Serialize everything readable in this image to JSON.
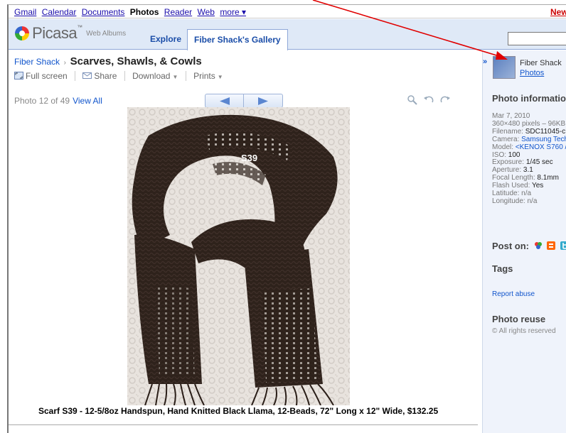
{
  "topnav": {
    "links": [
      "Gmail",
      "Calendar",
      "Documents",
      "Photos",
      "Reader",
      "Web"
    ],
    "current": "Photos",
    "more": "more ▾",
    "new_label": "New"
  },
  "header": {
    "logo_word": "Picasa",
    "logo_tm": "™",
    "logo_sub": "Web Albums",
    "tabs": [
      "Explore",
      "Fiber Shack's Gallery"
    ]
  },
  "breadcrumb": {
    "owner": "Fiber Shack",
    "separator": "›",
    "album": "Scarves, Shawls, & Cowls"
  },
  "toolbar": {
    "fullscreen": "Full screen",
    "share": "Share",
    "download": "Download",
    "prints": "Prints"
  },
  "photo_nav": {
    "counter": "Photo 12 of 49",
    "view_all": "View All"
  },
  "photo": {
    "label": "S39",
    "caption": "Scarf S39 - 12-5/8oz Handspun, Hand Knitted Black Llama, 12-Beads, 72\" Long x 12\" Wide, $132.25"
  },
  "sidebar": {
    "owner_name": "Fiber Shack",
    "owner_photos": "Photos",
    "info_heading": "Photo information",
    "info": {
      "date": "Mar 7, 2010",
      "dimensions": "360×480 pixels – 96KB",
      "filename_label": "Filename:",
      "filename": "SDC11045-c",
      "camera_label": "Camera:",
      "camera": "Samsung Tech",
      "model_label": "Model:",
      "model": "<KENOX S760 /",
      "iso_label": "ISO:",
      "iso": "100",
      "exposure_label": "Exposure:",
      "exposure": "1/45 sec",
      "aperture_label": "Aperture:",
      "aperture": "3.1",
      "focal_label": "Focal Length:",
      "focal": "8.1mm",
      "flash_label": "Flash Used:",
      "flash": "Yes",
      "latitude": "Latitude: n/a",
      "longitude": "Longitude: n/a"
    },
    "post_on": "Post on:",
    "tags_heading": "Tags",
    "report_abuse": "Report abuse",
    "reuse_heading": "Photo reuse",
    "rights": "All rights reserved"
  },
  "icons": {
    "collapse": "»",
    "annotation_color": "#e00000"
  }
}
